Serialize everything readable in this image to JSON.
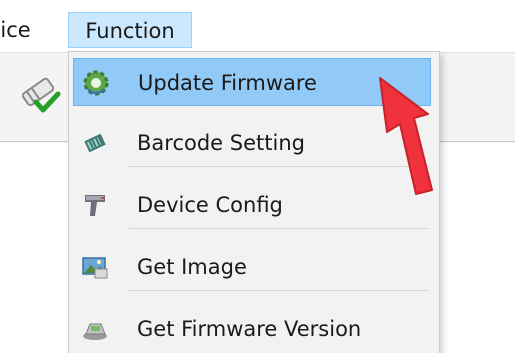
{
  "menubar": {
    "device_label": "vice",
    "function_label": "Function"
  },
  "function_menu": {
    "items": [
      {
        "label": "Update Firmware",
        "icon": "gear-update-icon",
        "highlighted": true
      },
      {
        "label": "Barcode Setting",
        "icon": "barcode-card-icon",
        "highlighted": false
      },
      {
        "label": "Device Config",
        "icon": "barcode-scanner-icon",
        "highlighted": false
      },
      {
        "label": "Get Image",
        "icon": "picture-icon",
        "highlighted": false
      },
      {
        "label": "Get Firmware Version",
        "icon": "device-version-icon",
        "highlighted": false
      }
    ]
  },
  "colors": {
    "menu_highlight": "#91c9f7",
    "menubar_highlight": "#cce8ff",
    "annotation_arrow": "#f0323c"
  }
}
